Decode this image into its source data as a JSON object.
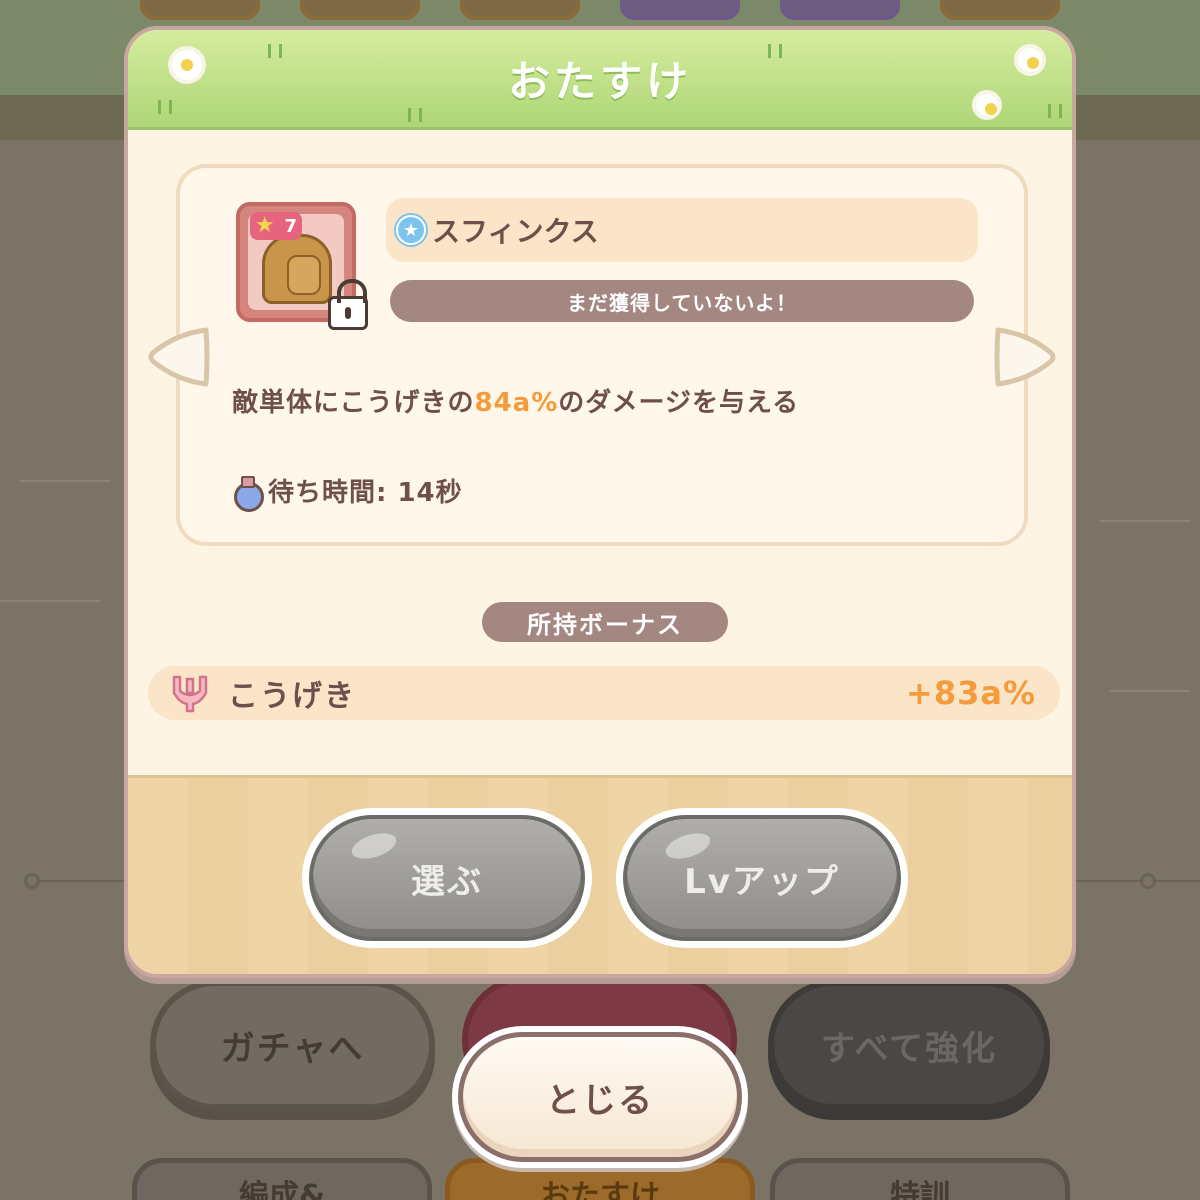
{
  "dialog": {
    "title": "おたすけ"
  },
  "character": {
    "name": "スフィンクス",
    "rarity": "7",
    "status": "まだ獲得していないよ！",
    "description_prefix": "敵単体にこうげきの",
    "description_value": "84a%",
    "description_suffix": "のダメージを与える",
    "wait_time": "待ち時間: 14秒"
  },
  "bonus": {
    "label": "所持ボーナス",
    "stat_name": "こうげき",
    "stat_value": "+83a%"
  },
  "actions": {
    "select_label": "選ぶ",
    "levelup_label": "Lvアップ",
    "close_label": "とじる"
  },
  "background": {
    "gacha_label": "ガチャへ",
    "upgrade_all_label": "すべて強化",
    "tab_formation": "編成&",
    "tab_otasuke": "おたすけ",
    "tab_training": "特訓"
  },
  "colors": {
    "header_green": "#aed676",
    "accent_orange": "#f49b3b",
    "text_brown": "#6e4f4a",
    "pill_brown": "#a48781"
  },
  "icons": {
    "rarity": "star-icon",
    "lock": "lock-icon",
    "wait": "potion-icon",
    "bonus": "attack-fork-icon",
    "prev": "chevron-left-icon",
    "next": "chevron-right-icon"
  }
}
